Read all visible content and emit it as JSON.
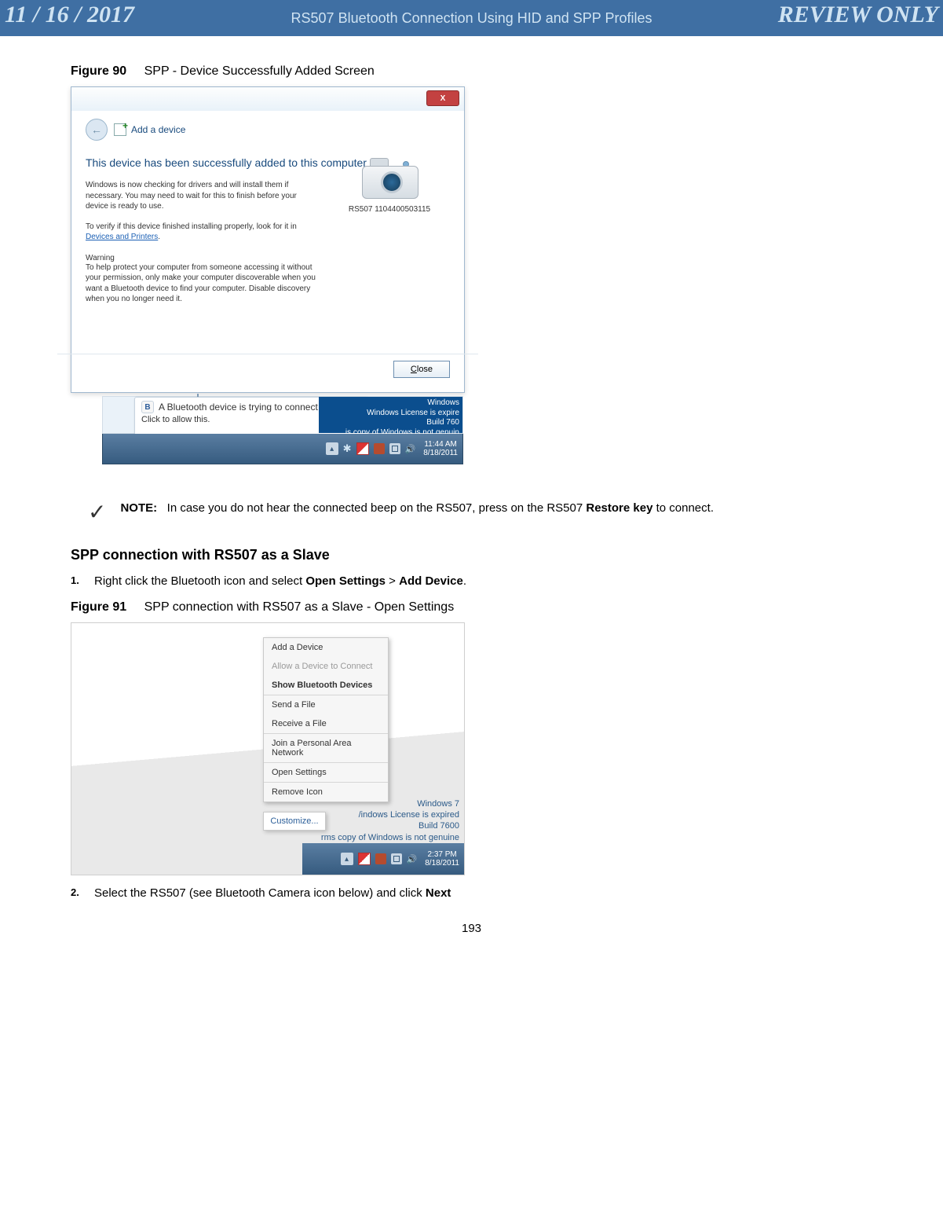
{
  "banner": {
    "date": "11 / 16 / 2017",
    "title": "RS507 Bluetooth Connection Using HID and SPP Profiles",
    "review": "REVIEW ONLY"
  },
  "fig90": {
    "label": "Figure 90",
    "caption": "SPP - Device Successfully Added Screen"
  },
  "win1": {
    "close_x": "X",
    "add_device": "Add a device",
    "success": "This device has been successfully added to this computer",
    "p1": "Windows is now checking for drivers and will install them if necessary. You may need to wait for this to finish before your device is ready to use.",
    "p2_a": "To verify if this device finished installing properly, look for it in ",
    "p2_link": "Devices and Printers",
    "p2_b": ".",
    "warn_h": "Warning",
    "warn_p": "To help protect your computer from someone accessing it without your permission, only make your computer discoverable when you want a Bluetooth device to find your computer. Disable discovery when you no longer need it.",
    "cam_label": "RS507 1104400503115",
    "close_btn_u": "C",
    "close_btn_rest": "lose"
  },
  "balloon": {
    "bt": "B",
    "title": "A Bluetooth device is trying to connect",
    "sub": "Click to allow this.",
    "wand": "↖",
    "x": "×"
  },
  "winlic1": {
    "l1": "Windows",
    "l2": "Windows License is expire",
    "l3": "Build 760",
    "l4": "is copy of Windows is not genuin"
  },
  "tray1": {
    "up": "▴",
    "clock_t": "11:44 AM",
    "clock_d": "8/18/2011",
    "spk": "🔊"
  },
  "note": {
    "check": "✓",
    "label": "NOTE:",
    "text_a": "In case you do not hear the connected beep on the RS507, press on the RS507 ",
    "bold": "Restore key",
    "text_b": " to connect."
  },
  "sec": {
    "h": "SPP connection with RS507 as a Slave"
  },
  "step1": {
    "a": "Right click the Bluetooth icon and select ",
    "b1": "Open Settings",
    "gt": " > ",
    "b2": "Add Device",
    "dot": "."
  },
  "fig91": {
    "label": "Figure 91",
    "caption": "SPP connection with RS507 as a Slave - Open Settings"
  },
  "ctx": {
    "i1": "Add a Device",
    "i2": "Allow a Device to Connect",
    "i3": "Show Bluetooth Devices",
    "i4": "Send a File",
    "i5": "Receive a File",
    "i6": "Join a Personal Area Network",
    "i7": "Open Settings",
    "i8": "Remove Icon"
  },
  "cust": "Customize...",
  "winlic2": {
    "l1": "Windows 7",
    "l2": "/indows License is expired",
    "l3": "Build 7600",
    "l4": "rms copy of Windows is not genuine"
  },
  "tray2": {
    "up": "▴",
    "clock_t": "2:37 PM",
    "clock_d": "8/18/2011",
    "spk": "🔊"
  },
  "step2": {
    "a": "Select the RS507 (see Bluetooth Camera icon below) and click ",
    "b": "Next"
  },
  "pgnum": "193"
}
